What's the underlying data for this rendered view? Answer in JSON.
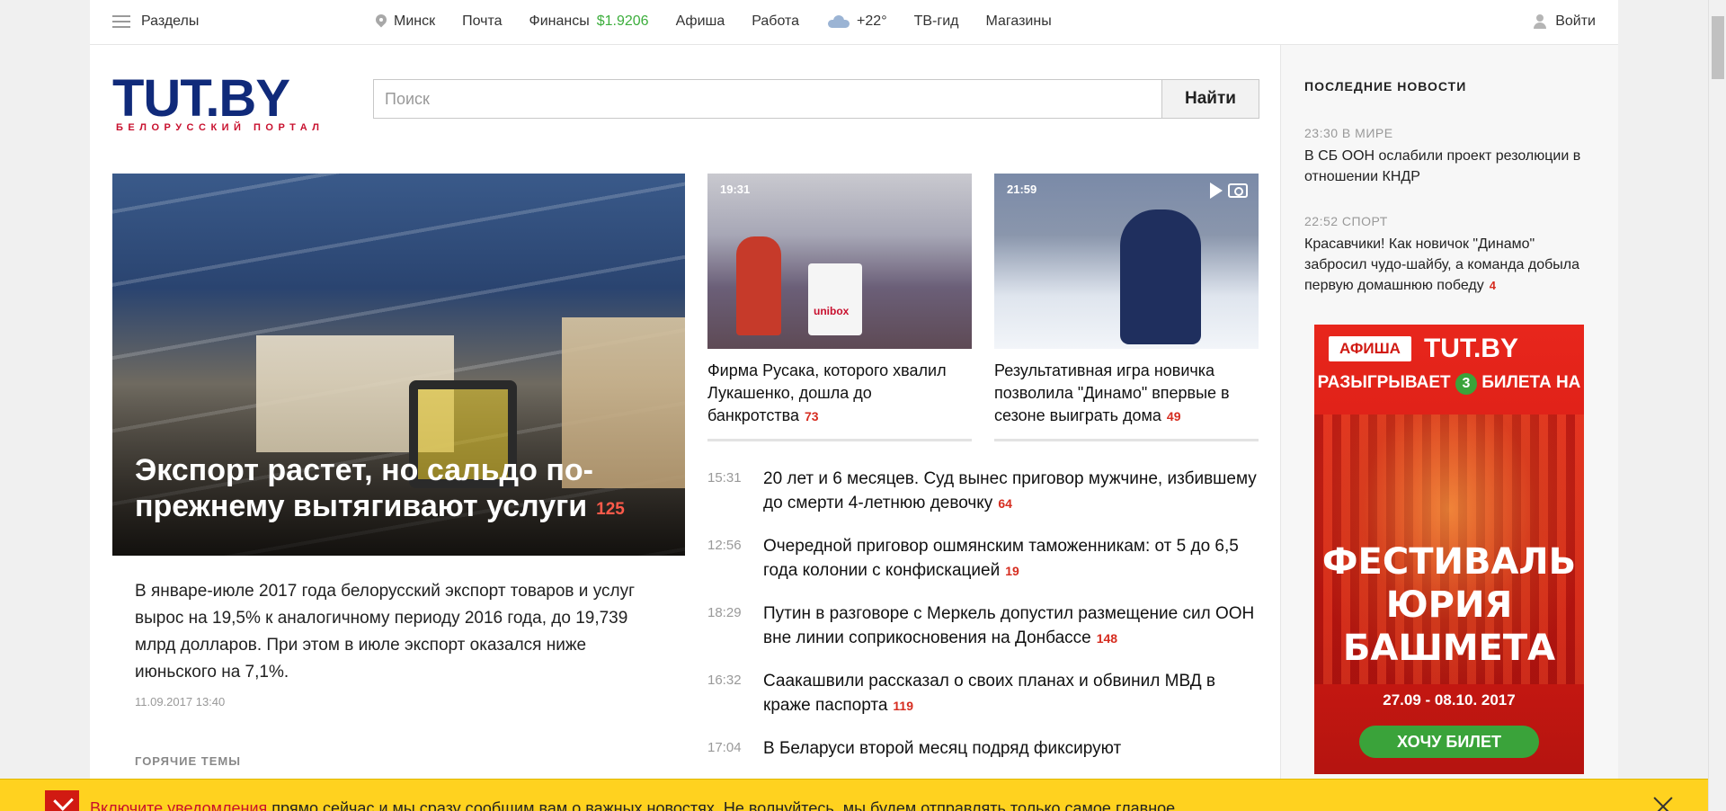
{
  "topnav": {
    "sections_label": "Разделы",
    "city": "Минск",
    "links": [
      "Почта",
      "Финансы",
      "Афиша",
      "Работа"
    ],
    "usd_rate": "$1.9206",
    "weather": "+22°",
    "links2": [
      "ТВ-гид",
      "Магазины"
    ],
    "login": "Войти"
  },
  "logo": {
    "name_left": "TUT.BY",
    "tagline": "БЕЛОРУССКИЙ ПОРТАЛ"
  },
  "search": {
    "placeholder": "Поиск",
    "button": "Найти"
  },
  "lead": {
    "title": "Экспорт растет, но сальдо по-прежнему вытягивают услуги",
    "comments": "125",
    "text": "В январе-июле 2017 года белорусский экспорт товаров и услуг вырос на 19,5% к аналогичному периоду 2016 года, до 19,739 млрд долларов. При этом в июле экспорт оказался ниже июньского на 7,1%.",
    "date": "11.09.2017 13:40"
  },
  "hot_topics_label": "ГОРЯЧИЕ ТЕМЫ",
  "cards": [
    {
      "time": "19:31",
      "title": "Фирма Русака, которого хвалил Лукашенко, дошла до банкротства",
      "comments": "73"
    },
    {
      "time": "21:59",
      "title": "Результативная игра новичка позволила \"Динамо\" впервые в сезоне выиграть дома",
      "comments": "49"
    }
  ],
  "news": [
    {
      "time": "15:31",
      "title": "20 лет и 6 месяцев. Суд вынес приговор мужчине, избившему до смерти 4-летнюю девочку",
      "comments": "64"
    },
    {
      "time": "12:56",
      "title": "Очередной приговор ошмянским таможенникам: от 5 до 6,5 года колонии с конфискацией",
      "comments": "19"
    },
    {
      "time": "18:29",
      "title": "Путин в разговоре с Меркель допустил размещение сил ООН вне линии соприкосновения на Донбассе",
      "comments": "148"
    },
    {
      "time": "16:32",
      "title": "Саакашвили рассказал о своих планах и обвинил МВД в краже паспорта",
      "comments": "119"
    },
    {
      "time": "17:04",
      "title": "В Беларуси второй месяц подряд фиксируют",
      "comments": ""
    }
  ],
  "sidebar": {
    "title": "ПОСЛЕДНИЕ НОВОСТИ",
    "items": [
      {
        "meta": "23:30 В МИРЕ",
        "title": "В СБ ООН ослабили проект резолюции в отношении КНДР",
        "comments": ""
      },
      {
        "meta": "22:52 СПОРТ",
        "title": "Красавчики! Как новичок \"Динамо\" забросил чудо-шайбу, а команда добыла первую домашнюю победу",
        "comments": "4"
      }
    ],
    "ad": {
      "afisha": "АФИША",
      "brand": "TUT.BY",
      "prize_before": "РАЗЫГРЫВАЕТ",
      "prize_num": "3",
      "prize_after": "БИЛЕТА НА",
      "fest_line1": "ФЕСТИВАЛЬ",
      "fest_line2": "ЮРИЯ",
      "fest_line3": "БАШМЕТА",
      "dates": "27.09 - 08.10. 2017",
      "button": "ХОЧУ БИЛЕТ"
    }
  },
  "notice": {
    "link": "Включите уведомления",
    "text": " прямо сейчас и мы сразу сообщим вам о важных новостях. Не волнуйтесь, мы будем отправлять только самое главное."
  },
  "colors": {
    "brand_blue": "#102a7a",
    "brand_red": "#c8102e",
    "usd_green": "#3cae3c",
    "notice_yellow": "#ffd21f"
  }
}
